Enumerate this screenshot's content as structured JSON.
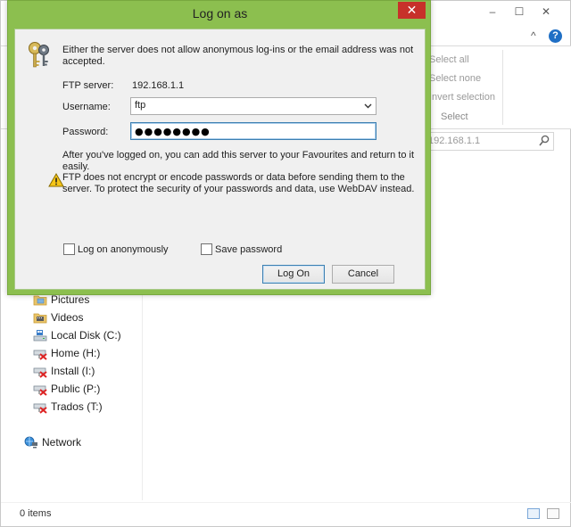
{
  "explorer": {
    "window_controls": {
      "minimize": "–",
      "maximize": "☐",
      "close": "✕"
    },
    "collapse_ribbon": "^",
    "help_icon": "?",
    "ribbon": {
      "select_all": "Select all",
      "select_none": "Select none",
      "invert_selection": "Invert selection",
      "group_label": "Select"
    },
    "search": {
      "value": "192.168.1.1"
    },
    "nav_items": [
      {
        "label": "Pictures",
        "icon": "pictures-folder-icon"
      },
      {
        "label": "Videos",
        "icon": "videos-folder-icon"
      },
      {
        "label": "Local Disk (C:)",
        "icon": "local-disk-icon"
      },
      {
        "label": "Home (H:)",
        "icon": "disconnected-network-drive-icon"
      },
      {
        "label": "Install (I:)",
        "icon": "disconnected-network-drive-icon"
      },
      {
        "label": "Public (P:)",
        "icon": "disconnected-network-drive-icon"
      },
      {
        "label": "Trados (T:)",
        "icon": "disconnected-network-drive-icon"
      },
      {
        "label": "Network",
        "icon": "network-icon"
      }
    ],
    "status": {
      "item_count": "0 items"
    }
  },
  "dialog": {
    "title": "Log on as",
    "close_label": "✕",
    "intro": "Either the server does not allow anonymous log-ins or the email address was not accepted.",
    "ftp_server_label": "FTP server:",
    "ftp_server_value": "192.168.1.1",
    "username_label": "Username:",
    "username_value": "ftp",
    "password_label": "Password:",
    "password_value": "●●●●●●●●",
    "after_logon_text": "After you've logged on, you can add this server to your Favourites and return to it easily.",
    "ftp_warning_text": "FTP does not encrypt or encode passwords or data before sending them to the server. To protect the security of your passwords and data, use WebDAV instead.",
    "anonymous_label": "Log on anonymously",
    "anonymous_checked": false,
    "save_password_label": "Save password",
    "save_password_checked": false,
    "logon_button": "Log On",
    "cancel_button": "Cancel"
  },
  "colors": {
    "dialog_frame": "#8cbf4f",
    "close_button": "#c7312a",
    "focus_border": "#3c7fb1"
  }
}
